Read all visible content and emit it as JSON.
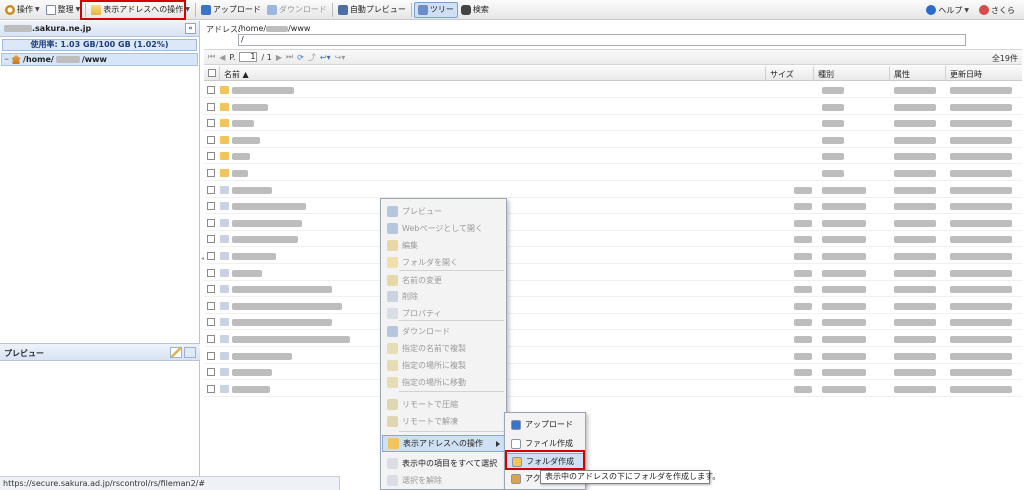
{
  "toolbar": {
    "ops_label": "操作",
    "manage_label": "整理",
    "address_ops_label": "表示アドレスへの操作",
    "upload_label": "アップロード",
    "download_label": "ダウンロード",
    "auto_preview_label": "自動プレビュー",
    "tree_label": "ツリー",
    "search_label": "検索",
    "help_label": "ヘルプ",
    "user_label": "さくら"
  },
  "left": {
    "domain_suffix": ".sakura.ne.jp",
    "collapse": "«",
    "quota_text": "使用率: 1.03 GB/100 GB (1.02%)",
    "tree_home_prefix": "/home/",
    "tree_home_suffix": "/www",
    "preview_title": "プレビュー"
  },
  "address": {
    "label": "アドレス:",
    "value_prefix": "/home/",
    "value_suffix": "/www",
    "input_value": "/"
  },
  "pager": {
    "page_prefix": "P.",
    "page_value": "1",
    "page_total": "/ 1",
    "count": "全19件"
  },
  "grid": {
    "columns": [
      "名前 ▲",
      "サイズ",
      "種別",
      "属性",
      "更新日時"
    ]
  },
  "context_menu": {
    "items": [
      {
        "label": "プレビュー",
        "enabled": false
      },
      {
        "label": "Webページとして開く",
        "enabled": false
      },
      {
        "label": "編集",
        "enabled": false
      },
      {
        "label": "フォルダを開く",
        "enabled": false
      },
      {
        "label": "名前の変更",
        "enabled": false
      },
      {
        "label": "削除",
        "enabled": false
      },
      {
        "label": "プロパティ",
        "enabled": false
      },
      {
        "label": "ダウンロード",
        "enabled": false
      },
      {
        "label": "指定の名前で複製",
        "enabled": false
      },
      {
        "label": "指定の場所に複製",
        "enabled": false
      },
      {
        "label": "指定の場所に移動",
        "enabled": false
      },
      {
        "label": "リモートで圧縮",
        "enabled": false
      },
      {
        "label": "リモートで解凍",
        "enabled": false
      },
      {
        "label": "表示アドレスへの操作",
        "enabled": true
      },
      {
        "label": "表示中の項目をすべて選択",
        "enabled": true
      },
      {
        "label": "選択を解除",
        "enabled": false
      }
    ]
  },
  "submenu": {
    "items": [
      "アップロード",
      "ファイル作成",
      "フォルダ作成",
      "アク"
    ]
  },
  "tooltip": "表示中のアドレスの下にフォルダを作成します。",
  "status_url": "https://secure.sakura.ad.jp/rscontrol/rs/fileman2/#",
  "colors": {
    "highlight_red": "#d40000",
    "selection_blue": "#cfe0f5",
    "folder_yellow": "#f2c55c"
  }
}
